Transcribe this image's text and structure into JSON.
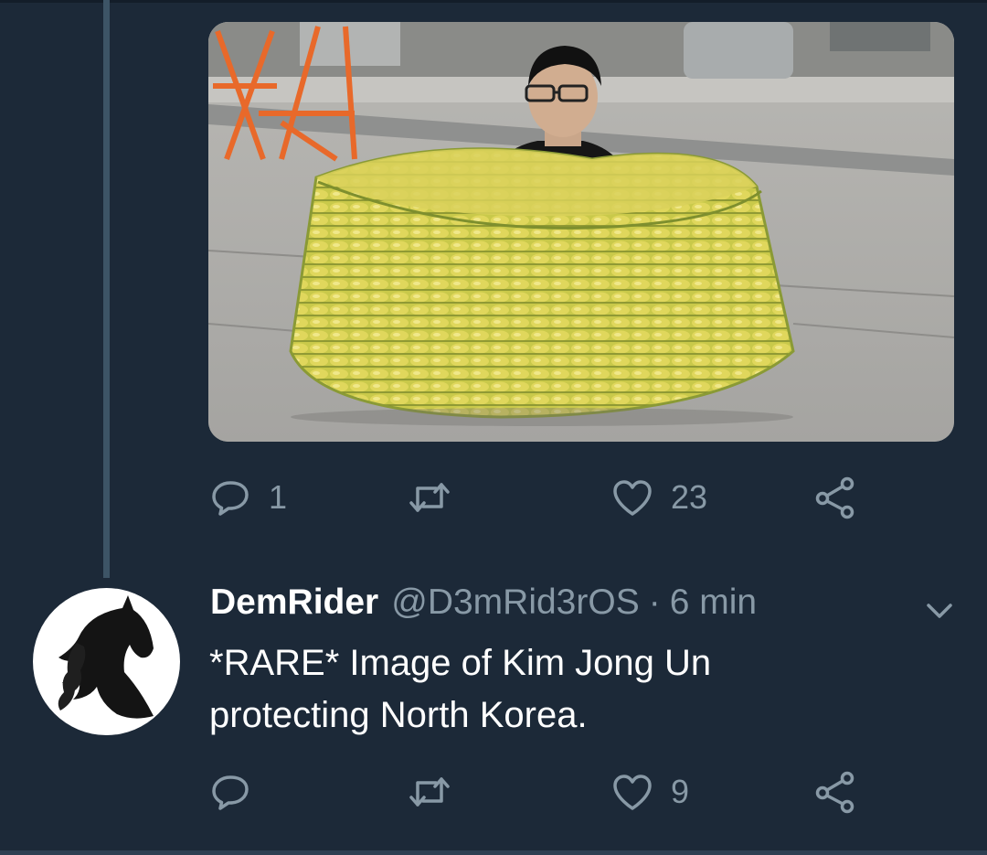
{
  "tweet1": {
    "media": {
      "description_icon": "photo"
    },
    "actions": {
      "reply_count": "1",
      "retweet_count": "",
      "like_count": "23"
    }
  },
  "tweet2": {
    "author": {
      "display_name": "DemRider",
      "handle": "@D3mRid3rOS",
      "separator": "·",
      "time": "6 min"
    },
    "text_lines": [
      "*RARE* Image of Kim Jong Un",
      "protecting North Korea."
    ],
    "actions": {
      "reply_count": "",
      "retweet_count": "",
      "like_count": "9"
    }
  },
  "colors": {
    "background": "#1c2938",
    "secondary_text": "#8899a6",
    "primary_text": "#ffffff",
    "thread_line": "#3d5466"
  },
  "icons": [
    "reply-icon",
    "retweet-icon",
    "like-icon",
    "share-icon",
    "chevron-down-icon",
    "horse-avatar-icon"
  ]
}
